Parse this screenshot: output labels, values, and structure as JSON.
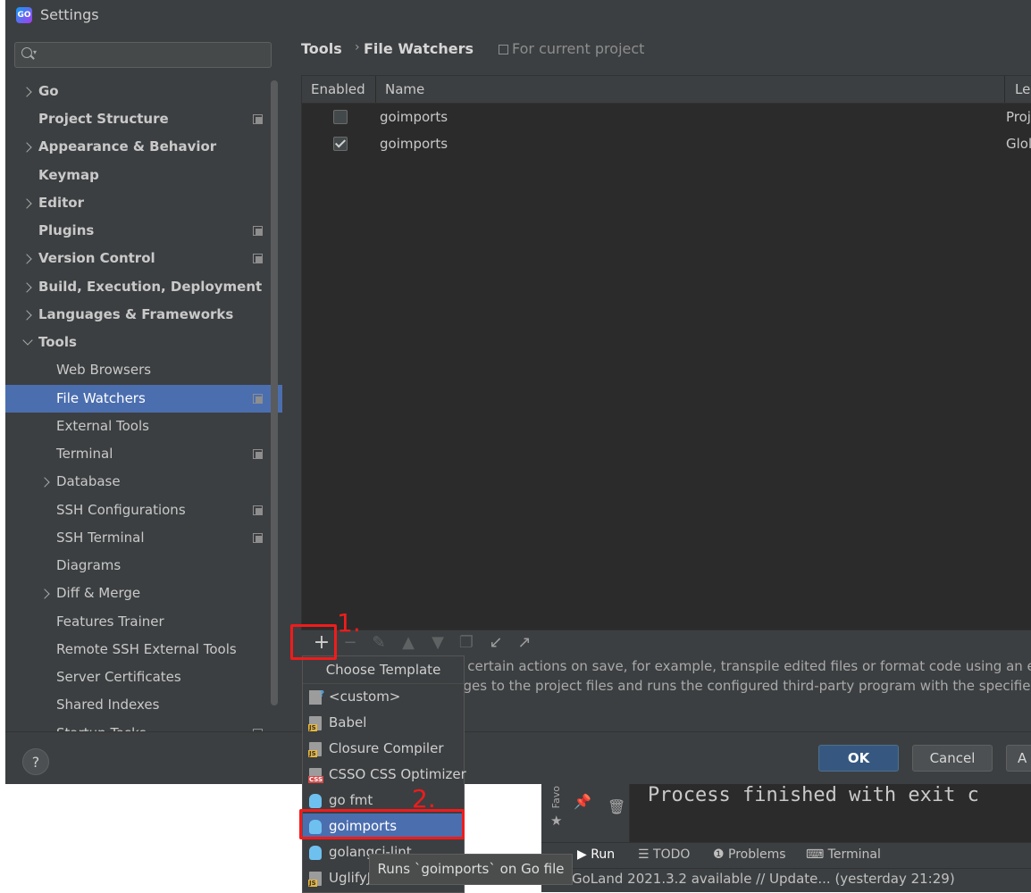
{
  "window": {
    "title": "Settings",
    "app_icon_label": "GO"
  },
  "search": {
    "placeholder": "",
    "value": ""
  },
  "sidebar": {
    "items": [
      {
        "label": "Go"
      },
      {
        "label": "Project Structure"
      },
      {
        "label": "Appearance & Behavior"
      },
      {
        "label": "Keymap"
      },
      {
        "label": "Editor"
      },
      {
        "label": "Plugins"
      },
      {
        "label": "Version Control"
      },
      {
        "label": "Build, Execution, Deployment"
      },
      {
        "label": "Languages & Frameworks"
      },
      {
        "label": "Tools"
      },
      {
        "label": "Web Browsers"
      },
      {
        "label": "File Watchers"
      },
      {
        "label": "External Tools"
      },
      {
        "label": "Terminal"
      },
      {
        "label": "Database"
      },
      {
        "label": "SSH Configurations"
      },
      {
        "label": "SSH Terminal"
      },
      {
        "label": "Diagrams"
      },
      {
        "label": "Diff & Merge"
      },
      {
        "label": "Features Trainer"
      },
      {
        "label": "Remote SSH External Tools"
      },
      {
        "label": "Server Certificates"
      },
      {
        "label": "Shared Indexes"
      },
      {
        "label": "Startup Tasks"
      }
    ]
  },
  "breadcrumb": {
    "parent": "Tools",
    "separator": "›",
    "current": "File Watchers",
    "scope": "For current project"
  },
  "table": {
    "columns": [
      "Enabled",
      "Name",
      "Le"
    ],
    "rows": [
      {
        "enabled": false,
        "name": "goimports",
        "level": "Proj"
      },
      {
        "enabled": true,
        "name": "goimports",
        "level": "Glol"
      }
    ]
  },
  "toolbar": {
    "add": "+",
    "remove": "−"
  },
  "description": {
    "line1": "n certain actions on save, for example, transpile edited files or format code using an exte",
    "line2": "nges to the project files and runs the configured third-party program with the specified"
  },
  "buttons": {
    "help": "?",
    "ok": "OK",
    "cancel": "Cancel",
    "apply": "A"
  },
  "popup": {
    "header": "Choose Template",
    "items": [
      {
        "label": "<custom>",
        "icon": "custom-template-icon"
      },
      {
        "label": "Babel",
        "icon": "js-file-icon"
      },
      {
        "label": "Closure Compiler",
        "icon": "js-file-icon"
      },
      {
        "label": "CSSO CSS Optimizer",
        "icon": "css-file-icon"
      },
      {
        "label": "go fmt",
        "icon": "go-gopher-icon"
      },
      {
        "label": "goimports",
        "icon": "go-gopher-icon"
      },
      {
        "label": "golangci-lint",
        "icon": "go-gopher-icon"
      },
      {
        "label": "UglifyJS",
        "icon": "js-file-icon"
      }
    ],
    "selected_index": 5
  },
  "tooltip": {
    "text": "Runs `goimports` on Go file"
  },
  "annotations": {
    "step1": "1.",
    "step2": "2.",
    "color": "#f21b1b"
  },
  "ide": {
    "console_text": "Process finished with exit c",
    "side_label": "Favo",
    "tabs": [
      "Run",
      "TODO",
      "Problems",
      "Terminal"
    ],
    "status": "GoLand 2021.3.2 available // Update... (yesterday 21:29)"
  },
  "colors": {
    "selection": "#4b6eaf",
    "ok_button": "#365880",
    "panel": "#3c3f41",
    "table_bg": "#2b2b2b"
  }
}
